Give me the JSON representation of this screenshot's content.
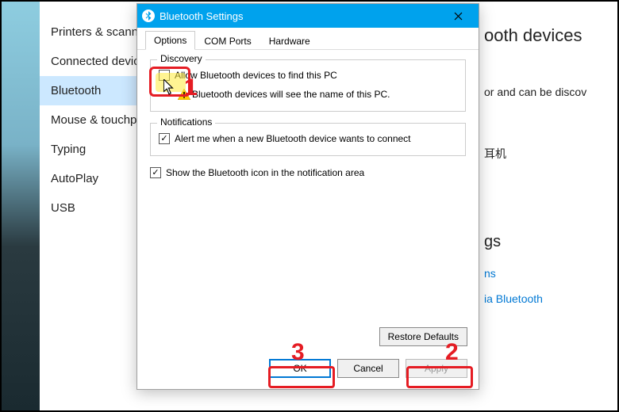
{
  "sidebar": {
    "items": [
      {
        "label": "Printers & scanners"
      },
      {
        "label": "Connected devices"
      },
      {
        "label": "Bluetooth"
      },
      {
        "label": "Mouse & touchpad"
      },
      {
        "label": "Typing"
      },
      {
        "label": "AutoPlay"
      },
      {
        "label": "USB"
      }
    ],
    "selected": 2
  },
  "right_pane": {
    "title_fragment": "ooth devices",
    "desc_fragment": "or and can be discov",
    "cjk_text": "耳机",
    "heading_fragment": "gs",
    "link1": "ns",
    "link2": "ia Bluetooth"
  },
  "dialog": {
    "title": "Bluetooth Settings",
    "tabs": [
      "Options",
      "COM Ports",
      "Hardware"
    ],
    "active_tab": 0,
    "discovery": {
      "legend": "Discovery",
      "allow_label": "Allow Bluetooth devices to find this PC",
      "allow_checked": false,
      "sub_text": "Bluetooth devices will see the name of this PC."
    },
    "notifications": {
      "legend": "Notifications",
      "alert_label": "Alert me when a new Bluetooth device wants to connect",
      "alert_checked": true
    },
    "show_icon": {
      "label": "Show the Bluetooth icon in the notification area",
      "checked": true
    },
    "buttons": {
      "restore": "Restore Defaults",
      "ok": "OK",
      "cancel": "Cancel",
      "apply": "Apply"
    }
  },
  "annotations": {
    "num1": "1",
    "num2": "2",
    "num3": "3"
  }
}
